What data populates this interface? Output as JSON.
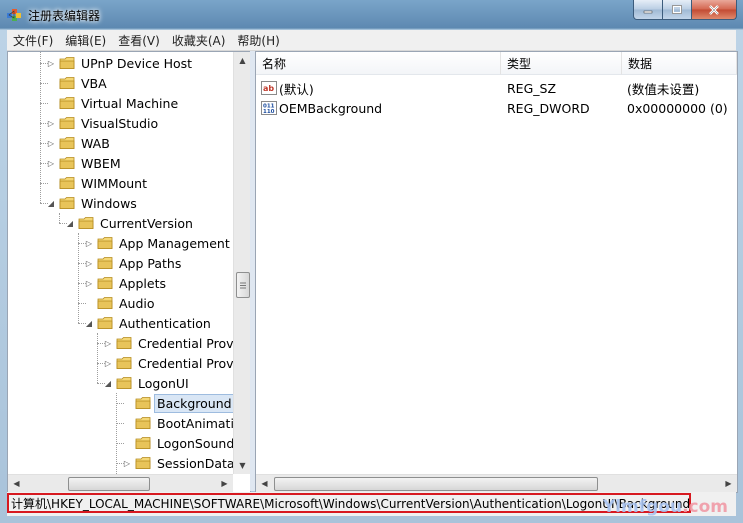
{
  "window": {
    "title": "注册表编辑器"
  },
  "menu": [
    {
      "id": "file",
      "label": "文件(F)"
    },
    {
      "id": "edit",
      "label": "编辑(E)"
    },
    {
      "id": "view",
      "label": "查看(V)"
    },
    {
      "id": "favorites",
      "label": "收藏夹(A)"
    },
    {
      "id": "help",
      "label": "帮助(H)"
    }
  ],
  "tree": {
    "items": [
      {
        "label": "UPnP Device Host",
        "expander": "collapsed",
        "level": 0
      },
      {
        "label": "VBA",
        "expander": "none",
        "level": 0
      },
      {
        "label": "Virtual Machine",
        "expander": "none",
        "level": 0
      },
      {
        "label": "VisualStudio",
        "expander": "collapsed",
        "level": 0
      },
      {
        "label": "WAB",
        "expander": "collapsed",
        "level": 0
      },
      {
        "label": "WBEM",
        "expander": "collapsed",
        "level": 0
      },
      {
        "label": "WIMMount",
        "expander": "none",
        "level": 0
      },
      {
        "label": "Windows",
        "expander": "expanded",
        "level": 0
      },
      {
        "label": "CurrentVersion",
        "expander": "expanded",
        "level": 1
      },
      {
        "label": "App Management",
        "expander": "collapsed",
        "level": 2
      },
      {
        "label": "App Paths",
        "expander": "collapsed",
        "level": 2
      },
      {
        "label": "Applets",
        "expander": "collapsed",
        "level": 2
      },
      {
        "label": "Audio",
        "expander": "none",
        "level": 2
      },
      {
        "label": "Authentication",
        "expander": "expanded",
        "level": 2
      },
      {
        "label": "Credential Provi",
        "expander": "collapsed",
        "level": 3
      },
      {
        "label": "Credential Provi",
        "expander": "collapsed",
        "level": 3
      },
      {
        "label": "LogonUI",
        "expander": "expanded",
        "level": 3
      },
      {
        "label": "Background",
        "expander": "none",
        "level": 4,
        "selected": true
      },
      {
        "label": "BootAnimatio",
        "expander": "none",
        "level": 4
      },
      {
        "label": "LogonSound",
        "expander": "none",
        "level": 4
      },
      {
        "label": "SessionData",
        "expander": "collapsed",
        "level": 4
      }
    ]
  },
  "values": {
    "columns": [
      {
        "id": "name",
        "label": "名称"
      },
      {
        "id": "type",
        "label": "类型"
      },
      {
        "id": "data",
        "label": "数据"
      }
    ],
    "rows": [
      {
        "icon": "string-value-icon",
        "name": "(默认)",
        "type": "REG_SZ",
        "data": "(数值未设置)"
      },
      {
        "icon": "binary-value-icon",
        "name": "OEMBackground",
        "type": "REG_DWORD",
        "data": "0x00000000 (0)"
      }
    ]
  },
  "status": {
    "path": "计算机\\HKEY_LOCAL_MACHINE\\SOFTWARE\\Microsoft\\Windows\\CurrentVersion\\Authentication\\LogonUI\\Background"
  },
  "watermark": {
    "text": "Ylmfgou",
    "suffix": ".com"
  },
  "colors": {
    "highlight_border": "#d71920",
    "selection": "#d9e6f5",
    "folder": "#e8c45a"
  }
}
